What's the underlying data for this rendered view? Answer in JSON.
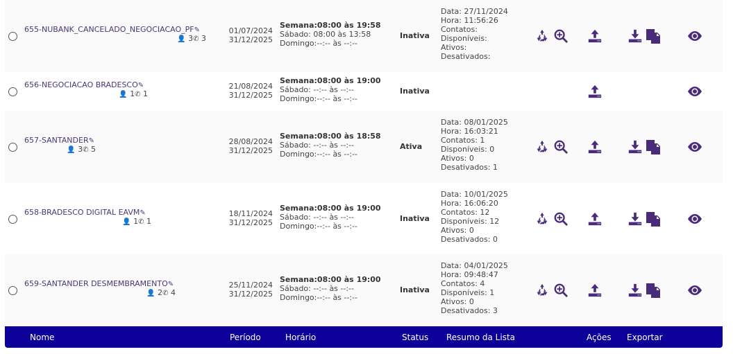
{
  "rows": [
    {
      "name": "655-NUBANK_CANCELADO_NEGOCIACAO_PF",
      "users": "3",
      "phones": "3",
      "start": "01/07/2024",
      "end": "31/12/2025",
      "semana": "Semana:08:00 às 19:58",
      "sabado": "Sábado:  08:00 às 13:58",
      "domingo": "Domingo:--:-- às --:--",
      "status": "Inativa",
      "summary": [
        "Data: 27/11/2024",
        "Hora: 11:56:26",
        "Contatos:",
        "Disponíveis:",
        "Ativos:",
        "Desativados:"
      ]
    },
    {
      "name": "656-NEGOCIACAO BRADESCO",
      "users": "1",
      "phones": "1",
      "start": "21/08/2024",
      "end": "31/12/2025",
      "semana": "Semana:08:00 às 19:00",
      "sabado": "Sábado:  --:-- às --:--",
      "domingo": "Domingo:--:-- às --:--",
      "status": "Inativa",
      "summary": []
    },
    {
      "name": "657-SANTANDER",
      "users": "3",
      "phones": "5",
      "start": "28/08/2024",
      "end": "31/12/2025",
      "semana": "Semana:08:00 às 18:58",
      "sabado": "Sábado:  --:-- às --:--",
      "domingo": "Domingo:--:-- às --:--",
      "status": "Ativa",
      "summary": [
        "Data: 08/01/2025",
        "Hora: 16:03:21",
        "Contatos: 1",
        "Disponíveis: 0",
        "Ativos: 0",
        "Desativados: 1"
      ]
    },
    {
      "name": "658-BRADESCO DIGITAL EAVM",
      "users": "1",
      "phones": "1",
      "start": "18/11/2024",
      "end": "31/12/2025",
      "semana": "Semana:08:00 às 19:00",
      "sabado": "Sábado:  --:-- às --:--",
      "domingo": "Domingo:--:-- às --:--",
      "status": "Inativa",
      "summary": [
        "Data: 10/01/2025",
        "Hora: 16:06:20",
        "Contatos: 12",
        "Disponíveis: 12",
        "Ativos: 0",
        "Desativados: 0"
      ]
    },
    {
      "name": "659-SANTANDER DESMEMBRAMENTO",
      "users": "2",
      "phones": "4",
      "start": "25/11/2024",
      "end": "31/12/2025",
      "semana": "Semana:08:00 às 19:00",
      "sabado": "Sábado:  --:-- às --:--",
      "domingo": "Domingo:--:-- às --:--",
      "status": "Inativa",
      "summary": [
        "Data: 04/01/2025",
        "Hora: 09:48:47",
        "Contatos: 4",
        "Disponíveis: 1",
        "Ativos: 0",
        "Desativados: 3"
      ]
    }
  ],
  "header": {
    "nome": "Nome",
    "periodo": "Período",
    "horario": "Horário",
    "status": "Status",
    "resumo": "Resumo da Lista",
    "acoes": "Ações",
    "exportar": "Exportar"
  },
  "icons": {
    "recycle": "recycle-icon",
    "search": "zoom-in-icon",
    "upload": "upload-icon",
    "download": "download-icon",
    "copy": "copy-icon",
    "eye": "eye-icon",
    "pencil": "pencil-icon",
    "user": "user-icon",
    "phone": "phone-icon"
  },
  "colors": {
    "accent": "#4a2b7a",
    "footer": "#0d0099"
  }
}
